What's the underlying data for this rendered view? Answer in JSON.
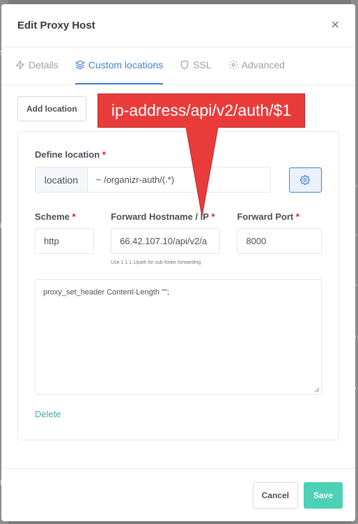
{
  "modal": {
    "title": "Edit Proxy Host",
    "close_glyph": "×"
  },
  "tabs": [
    {
      "label": "Details",
      "icon": "zap-icon",
      "active": false
    },
    {
      "label": "Custom locations",
      "icon": "layers-icon",
      "active": true
    },
    {
      "label": "SSL",
      "icon": "shield-icon",
      "active": false
    },
    {
      "label": "Advanced",
      "icon": "gear-icon",
      "active": false
    }
  ],
  "add_location_label": "Add location",
  "annotation": {
    "text": "ip-address/api/v2/auth/$1",
    "color": "#ea3b3b"
  },
  "location": {
    "define_label": "Define location",
    "required_mark": "*",
    "prefix": "location",
    "value": "~ /organizr-auth/(.*)"
  },
  "fields": {
    "scheme_label": "Scheme",
    "scheme_value": "http",
    "hostname_label": "Forward Hostname / IP",
    "hostname_value": "66.42.107.10/api/v2/a",
    "hostname_hint": "Use 1.1.1.1/path for sub-folder forwarding",
    "port_label": "Forward Port",
    "port_value": "8000"
  },
  "advanced_config": "proxy_set_header Content-Length \"\";",
  "delete_label": "Delete",
  "footer": {
    "cancel_label": "Cancel",
    "save_label": "Save"
  },
  "colors": {
    "accent": "#467fcf",
    "save": "#4cd1b5",
    "required": "#cd201f",
    "link": "#45aaa0"
  },
  "background": {
    "fragments": [
      "SS",
      "Er",
      "y",
      "y",
      "y",
      "y",
      "y",
      "Fs"
    ]
  }
}
